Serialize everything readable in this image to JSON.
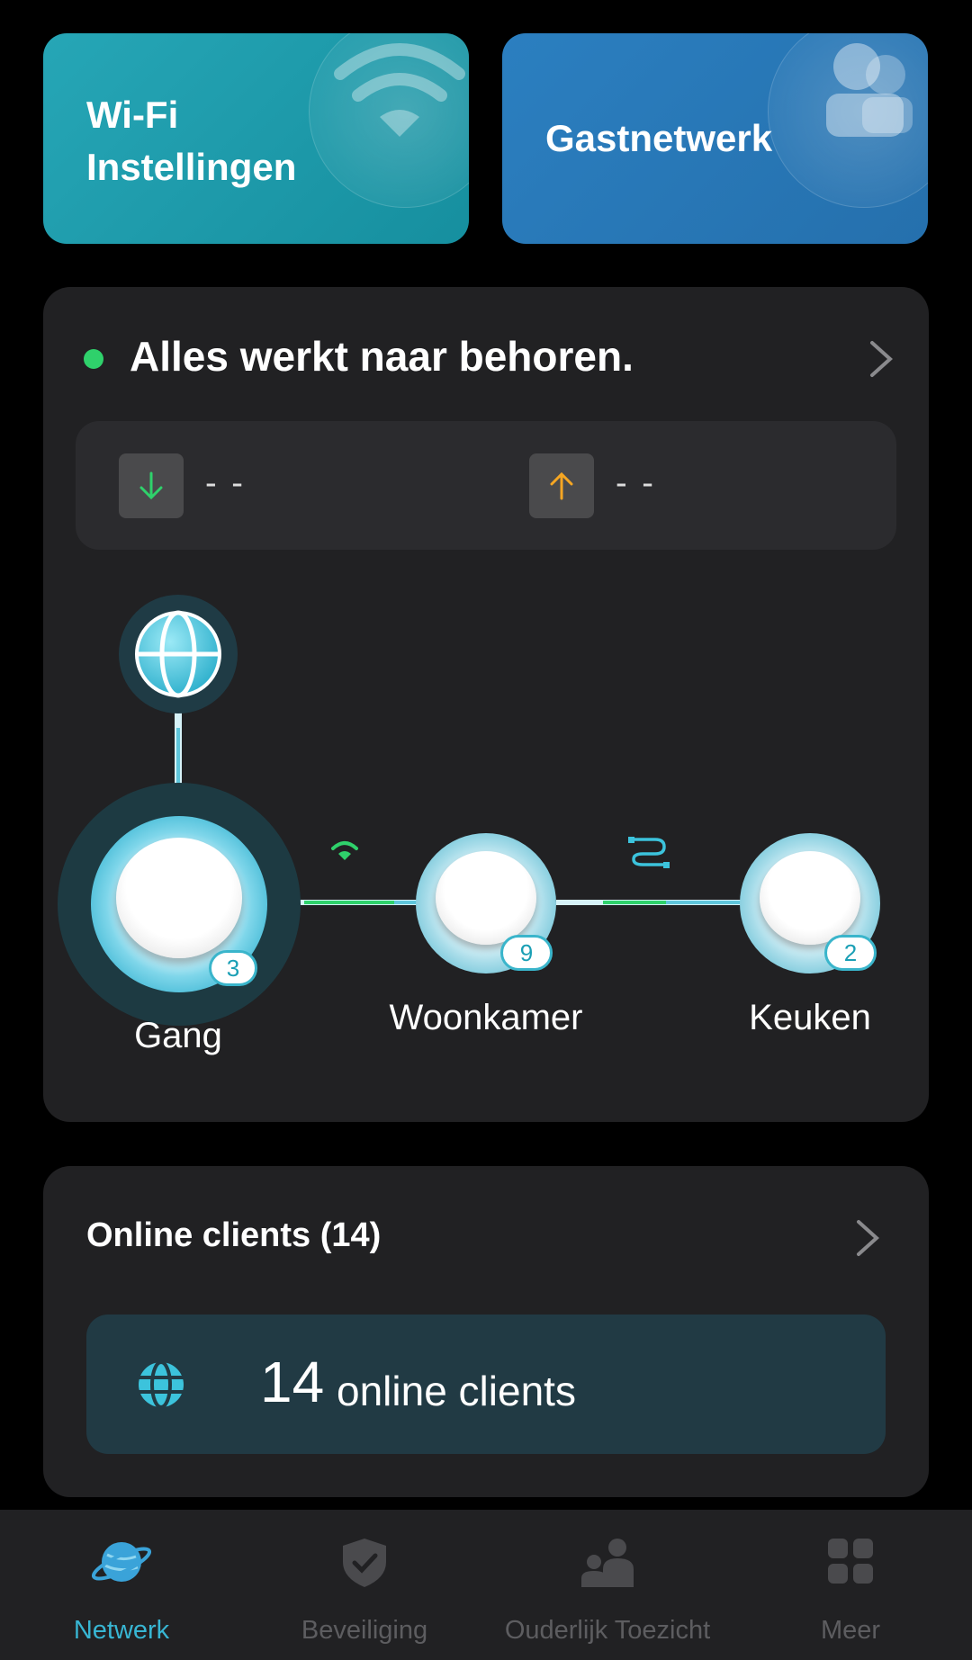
{
  "tiles": {
    "wifi": {
      "label": "Wi-Fi Instellingen",
      "icon": "wifi-icon"
    },
    "guest": {
      "label": "Gastnetwerk",
      "icon": "people-icon"
    }
  },
  "status": {
    "message": "Alles werkt naar behoren.",
    "indicator_color": "#2fd16b",
    "download": {
      "value": "- -",
      "icon": "arrow-down-icon",
      "color": "#2fd16b"
    },
    "upload": {
      "value": "- -",
      "icon": "arrow-up-icon",
      "color": "#f5a623"
    }
  },
  "topology": {
    "internet_icon": "internet-globe-icon",
    "nodes": [
      {
        "name": "Gang",
        "clients": "3",
        "role": "main"
      },
      {
        "name": "Woonkamer",
        "clients": "9",
        "link": "wifi-icon"
      },
      {
        "name": "Keuken",
        "clients": "2",
        "link": "ethernet-cable-icon"
      }
    ]
  },
  "clients": {
    "title": "Online clients (14)",
    "count": "14",
    "suffix": "online clients",
    "icon": "globe-icon"
  },
  "tabs": [
    {
      "label": "Netwerk",
      "icon": "planet-icon",
      "active": true
    },
    {
      "label": "Beveiliging",
      "icon": "shield-check-icon",
      "active": false
    },
    {
      "label": "Ouderlijk Toezicht",
      "icon": "family-icon",
      "active": false
    },
    {
      "label": "Meer",
      "icon": "grid-icon",
      "active": false
    }
  ],
  "colors": {
    "accent": "#38b6d3",
    "wifi_tile": "#1e9aab",
    "guest_tile": "#2a78b8",
    "card": "#212123"
  }
}
